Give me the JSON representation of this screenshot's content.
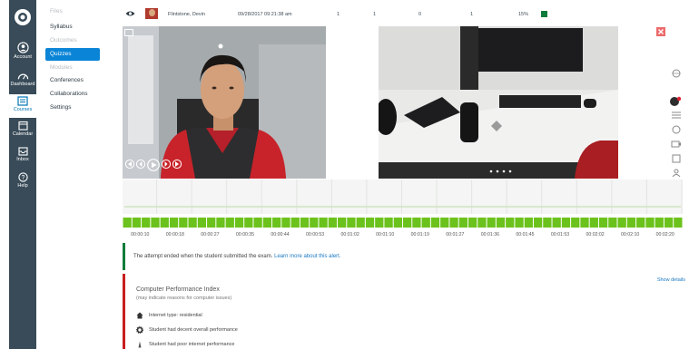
{
  "global_nav": {
    "items": [
      {
        "key": "account",
        "label": "Account"
      },
      {
        "key": "dashboard",
        "label": "Dashboard"
      },
      {
        "key": "courses",
        "label": "Courses"
      },
      {
        "key": "calendar",
        "label": "Calendar"
      },
      {
        "key": "inbox",
        "label": "Inbox"
      },
      {
        "key": "help",
        "label": "Help"
      }
    ],
    "bg_color": "#394b58"
  },
  "course_nav": {
    "items": [
      {
        "label": "Files",
        "state": "dim"
      },
      {
        "label": "Syllabus",
        "state": "normal"
      },
      {
        "label": "Outcomes",
        "state": "dim"
      },
      {
        "label": "Quizzes",
        "state": "active"
      },
      {
        "label": "Modules",
        "state": "dim"
      },
      {
        "label": "Conferences",
        "state": "normal"
      },
      {
        "label": "Collaborations",
        "state": "normal"
      },
      {
        "label": "Settings",
        "state": "normal"
      }
    ]
  },
  "student_row": {
    "name": "Flintstone, Devin",
    "datetime": "09/28/2017 09:21:38 am",
    "col1": "1",
    "col2": "1",
    "col3": "0",
    "col4": "1",
    "percent": "15%",
    "status_color": "#0e7c3a"
  },
  "timeline": {
    "labels": [
      "00:00:10",
      "00:00:18",
      "00:00:27",
      "00:00:35",
      "00:00:44",
      "00:00:53",
      "00:01:02",
      "00:01:10",
      "00:01:19",
      "00:01:27",
      "00:01:36",
      "00:01:45",
      "00:01:53",
      "00:02:02",
      "00:02:10",
      "00:02:20"
    ],
    "bar_color": "#6cc21c"
  },
  "alert": {
    "text": "The attempt ended when the student submitted the exam.",
    "link": "Learn more about this alert."
  },
  "performance": {
    "show_details": "Show details",
    "title": "Computer Performance Index",
    "subtitle": "(may indicate reasons for computer issues)",
    "items": [
      "Internet type: residential",
      "Student had decent overall performance",
      "Student had poor internet performance"
    ]
  }
}
